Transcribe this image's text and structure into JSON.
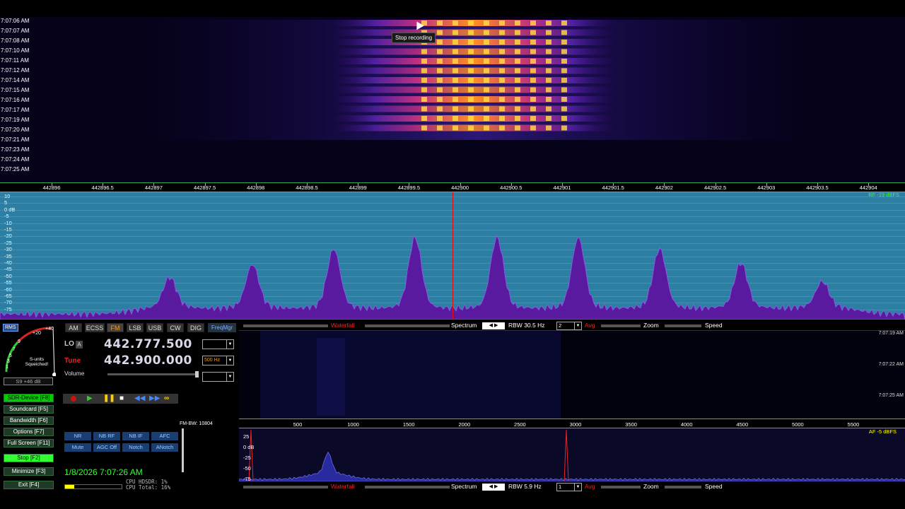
{
  "waterfall_times": [
    "7:07:06 AM",
    "7:07:07 AM",
    "7:07:08 AM",
    "7:07:10 AM",
    "7:07:11 AM",
    "7:07:12 AM",
    "7:07:14 AM",
    "7:07:15 AM",
    "7:07:16 AM",
    "7:07:17 AM",
    "7:07:19 AM",
    "7:07:20 AM",
    "7:07:21 AM",
    "7:07:23 AM",
    "7:07:24 AM",
    "7:07:25 AM"
  ],
  "tooltip": "Stop recording",
  "freq_scale": [
    "442896",
    "442896.5",
    "442897",
    "442897.5",
    "442898",
    "442898.5",
    "442899",
    "442899.5",
    "442900",
    "442900.5",
    "442901",
    "442901.5",
    "442902",
    "442902.5",
    "442903",
    "442903.5",
    "442904"
  ],
  "db_labels": [
    "10",
    "5",
    "0 dB",
    "-5",
    "-10",
    "-15",
    "-20",
    "-25",
    "-30",
    "-35",
    "-40",
    "-45",
    "-50",
    "-55",
    "-60",
    "-65",
    "-70",
    "-75",
    "-80"
  ],
  "rf_level": "RF -19 dBFS",
  "meter": {
    "rms": "RMS",
    "scale": [
      "+40",
      "+20",
      "9",
      "7",
      "5",
      "3",
      "1"
    ],
    "caption": "S-units Squeiched!",
    "reading": "S9 +46 dB"
  },
  "modes": [
    "AM",
    "ECSS",
    "FM",
    "LSB",
    "USB",
    "CW",
    "DIG"
  ],
  "active_mode": "FM",
  "freqmgr": "FreqMgr",
  "lo": {
    "label": "LO",
    "badge": "A",
    "value": "442.777.500"
  },
  "tune": {
    "label": "Tune",
    "value": "442.900.000",
    "step": "500 Hz"
  },
  "volume_label": "Volume",
  "side_buttons": [
    "SDR-Device [F8]",
    "Soundcard [F5]",
    "Bandwidth [F6]",
    "Options [F7]",
    "Full Screen [F11]",
    "Stop [F2]",
    "Minimize [F3]",
    "Exit [F4]"
  ],
  "dsp_row1": [
    "NR",
    "NB RF",
    "NB IF",
    "AFC"
  ],
  "dsp_row2": [
    "Mute",
    "AGC Off",
    "Notch",
    "ANotch"
  ],
  "fm_bw": "FM-BW: 10804",
  "datetime": "1/8/2026 7:07:26 AM",
  "cpu_hdsdr": "CPU HDSDR:  1%",
  "cpu_total": "CPU Total: 16%",
  "toolbar_top": {
    "waterfall": "Waterfall",
    "spectrum": "Spectrum",
    "rbw": "RBW 30.5 Hz",
    "avg_val": "2",
    "avg": "Avg",
    "zoom": "Zoom",
    "speed": "Speed"
  },
  "toolbar_bottom": {
    "waterfall": "Waterfall",
    "spectrum": "Spectrum",
    "rbw": "RBW  5.9 Hz",
    "avg_val": "1",
    "avg": "Avg",
    "zoom": "Zoom",
    "speed": "Speed"
  },
  "af_times": [
    "7:07:19 AM",
    "7:07:22 AM",
    "7:07:25 AM"
  ],
  "af_scale": [
    "500",
    "1000",
    "1500",
    "2000",
    "2500",
    "3000",
    "3500",
    "4000",
    "4500",
    "5000",
    "5500"
  ],
  "af_db": [
    "25",
    "0 dB",
    "-25",
    "-50",
    "-75"
  ],
  "af_level": "AF -5 dBFS",
  "colors": {
    "spectrum_bg": "#2c7fa2",
    "spectrum_fill": "#5a1aa0",
    "active_green": "#00cc00",
    "accent_orange": "#ff9900"
  }
}
